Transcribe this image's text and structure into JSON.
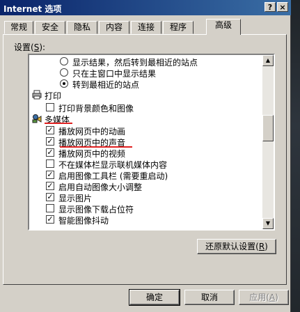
{
  "window": {
    "title": "Internet 选项",
    "help_label": "?",
    "close_label": "×"
  },
  "tabs": [
    {
      "label": "常规"
    },
    {
      "label": "安全"
    },
    {
      "label": "隐私"
    },
    {
      "label": "内容"
    },
    {
      "label": "连接"
    },
    {
      "label": "程序"
    },
    {
      "label": "高级",
      "active": true
    }
  ],
  "settings": {
    "label": "设置",
    "hotkey": "S",
    "items": [
      {
        "kind": "radio",
        "checked": false,
        "label": "显示结果，然后转到最相近的站点"
      },
      {
        "kind": "radio",
        "checked": false,
        "label": "只在主窗口中显示结果"
      },
      {
        "kind": "radio",
        "checked": true,
        "label": "转到最相近的站点"
      },
      {
        "kind": "category",
        "icon": "printer-icon",
        "label": "打印"
      },
      {
        "kind": "checkbox",
        "checked": false,
        "label": "打印背景颜色和图像"
      },
      {
        "kind": "category",
        "icon": "multimedia-icon",
        "label": "多媒体"
      },
      {
        "kind": "checkbox",
        "checked": true,
        "label": "播放网页中的动画"
      },
      {
        "kind": "checkbox",
        "checked": true,
        "label": "播放网页中的声音"
      },
      {
        "kind": "checkbox",
        "checked": true,
        "label": "播放网页中的视频"
      },
      {
        "kind": "checkbox",
        "checked": false,
        "label": "不在媒体栏显示联机媒体内容"
      },
      {
        "kind": "checkbox",
        "checked": true,
        "label": "启用图像工具栏 (需要重启动)"
      },
      {
        "kind": "checkbox",
        "checked": true,
        "label": "启用自动图像大小调整"
      },
      {
        "kind": "checkbox",
        "checked": true,
        "label": "显示图片"
      },
      {
        "kind": "checkbox",
        "checked": false,
        "label": "显示图像下载占位符"
      },
      {
        "kind": "checkbox",
        "checked": true,
        "label": "智能图像抖动"
      }
    ]
  },
  "restore_button": {
    "label": "还原默认设置",
    "hotkey": "R"
  },
  "footer": {
    "ok_label": "确定",
    "cancel_label": "取消",
    "apply_label": "应用",
    "apply_hotkey": "A"
  },
  "colors": {
    "title_start": "#0a246a",
    "title_end": "#3a6ea5",
    "annotation": "#e02020"
  }
}
